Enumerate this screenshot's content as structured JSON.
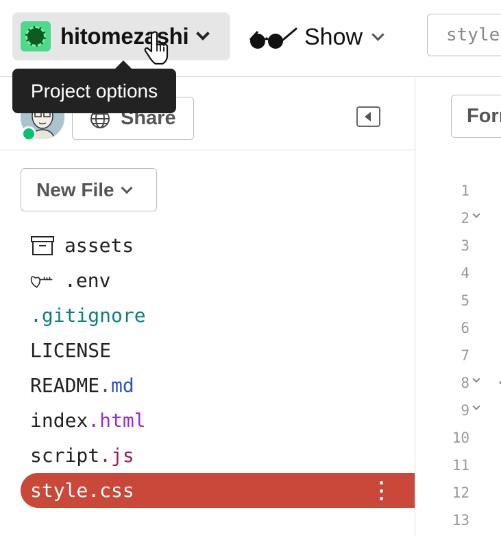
{
  "header": {
    "project": {
      "name": "hitomezashi",
      "avatar_icon": "project-avatar-icon",
      "accent": "#4fd88c"
    },
    "show": {
      "label": "Show",
      "icon": "glasses-icon"
    },
    "file_tab": {
      "label": "style"
    }
  },
  "tooltip": {
    "text": "Project options"
  },
  "sidebar": {
    "share_label": "Share",
    "new_file_label": "New File",
    "files": [
      {
        "base": "assets",
        "ext": "",
        "icon": "archive-icon"
      },
      {
        "base": ".env",
        "ext": "",
        "icon": "key-icon"
      },
      {
        "base": ".gitignore",
        "ext": ""
      },
      {
        "base": "LICENSE",
        "ext": ""
      },
      {
        "base": "README",
        "ext": ".md"
      },
      {
        "base": "index",
        "ext": ".html"
      },
      {
        "base": "script",
        "ext": ".js"
      },
      {
        "base": "style.css",
        "ext": "",
        "active": true
      }
    ],
    "active_color": "#c9483a"
  },
  "editor": {
    "format_label": "Format",
    "line_numbers": [
      "1",
      "2",
      "3",
      "4",
      "5",
      "6",
      "7",
      "8",
      "9",
      "10",
      "11",
      "12",
      "13"
    ]
  }
}
